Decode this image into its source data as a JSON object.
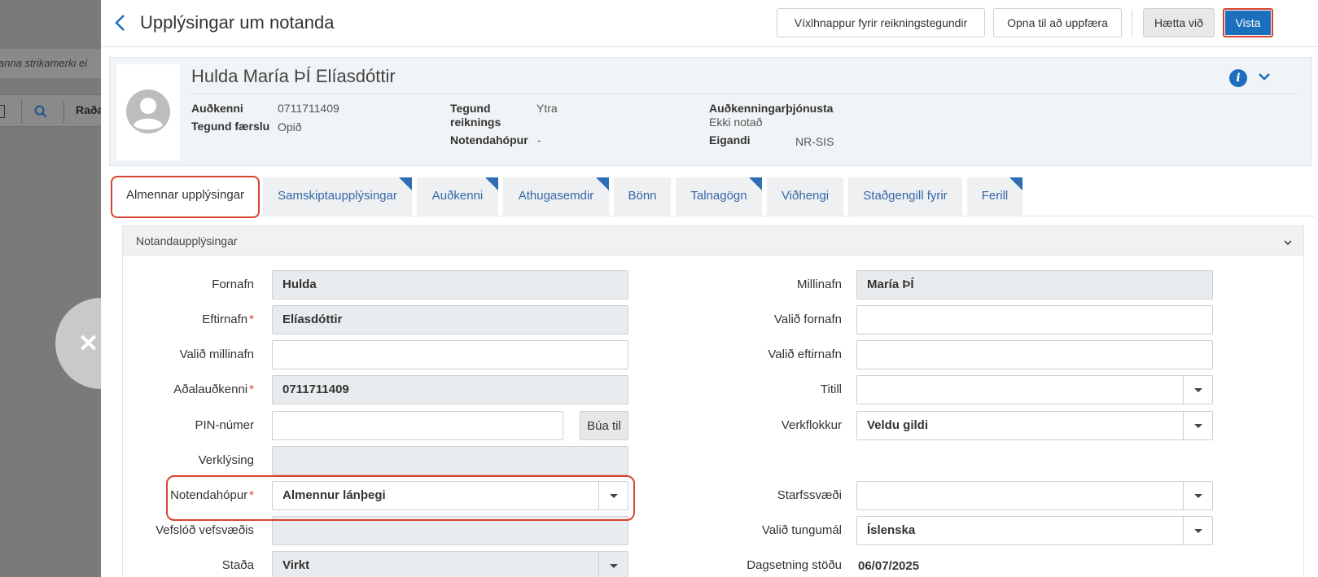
{
  "background": {
    "strip_text": "anna strikamerki ei",
    "toolbar_label": "Raða"
  },
  "header": {
    "title": "Upplýsingar um notanda",
    "buttons": {
      "toggle_account_types": "Víxlhnappur fyrir reikningstegundir",
      "open_to_update": "Opna til að uppfæra",
      "cancel": "Hætta við",
      "save": "Vista"
    }
  },
  "user": {
    "name": "Hulda María ÞÍ Elíasdóttir",
    "id_label": "Auðkenni",
    "id_value": "0711711409",
    "record_type_label": "Tegund færslu",
    "record_type_value": "Opið",
    "account_type_label_1": "Tegund",
    "account_type_label_2": "reiknings",
    "account_type_value": "Ytra",
    "user_group_label": "Notendahópur",
    "user_group_value": "-",
    "auth_service_label": "Auðkenningarþjónusta",
    "auth_service_value": "Ekki notað",
    "owner_label": "Eigandi",
    "owner_value": "NR-SIS"
  },
  "tabs": [
    {
      "label": "Almennar upplýsingar",
      "active": true
    },
    {
      "label": "Samskiptaupplýsingar",
      "flag": true
    },
    {
      "label": "Auðkenni",
      "flag": true
    },
    {
      "label": "Athugasemdir",
      "flag": true
    },
    {
      "label": "Bönn"
    },
    {
      "label": "Talnagögn",
      "flag": true
    },
    {
      "label": "Viðhengi"
    },
    {
      "label": "Staðgengill fyrir"
    },
    {
      "label": "Ferill",
      "flag": true
    }
  ],
  "section": {
    "title": "Notandaupplýsingar"
  },
  "form": {
    "first_name": {
      "label": "Fornafn",
      "value": "Hulda"
    },
    "last_name": {
      "label": "Eftirnafn",
      "value": "Elíasdóttir",
      "required": "*"
    },
    "pref_middle": {
      "label": "Valið millinafn",
      "value": ""
    },
    "primary_id": {
      "label": "Aðalauðkenni",
      "value": "0711711409",
      "required": "*"
    },
    "pin": {
      "label": "PIN-númer",
      "value": "",
      "button": "Búa til"
    },
    "job_desc": {
      "label": "Verklýsing",
      "value": ""
    },
    "user_group": {
      "label": "Notendahópur",
      "value": "Almennur lánþegi",
      "required": "*"
    },
    "campus_url": {
      "label": "Vefslóð vefsvæðis",
      "value": ""
    },
    "status": {
      "label": "Staða",
      "value": "Virkt"
    },
    "middle_name": {
      "label": "Millinafn",
      "value": "María ÞÍ"
    },
    "pref_first": {
      "label": "Valið fornafn",
      "value": ""
    },
    "pref_last": {
      "label": "Valið eftirnafn",
      "value": ""
    },
    "title": {
      "label": "Titill",
      "value": ""
    },
    "job_category": {
      "label": "Verkflokkur",
      "value": "Veldu gildi"
    },
    "campus": {
      "label": "Starfssvæði",
      "value": ""
    },
    "pref_language": {
      "label": "Valið tungumál",
      "value": "Íslenska"
    },
    "status_date": {
      "label": "Dagsetning stöðu",
      "value": "06/07/2025"
    }
  },
  "colors": {
    "accent": "#1b6fbd",
    "highlight": "#d9432f",
    "tab_link": "#3467a8"
  }
}
